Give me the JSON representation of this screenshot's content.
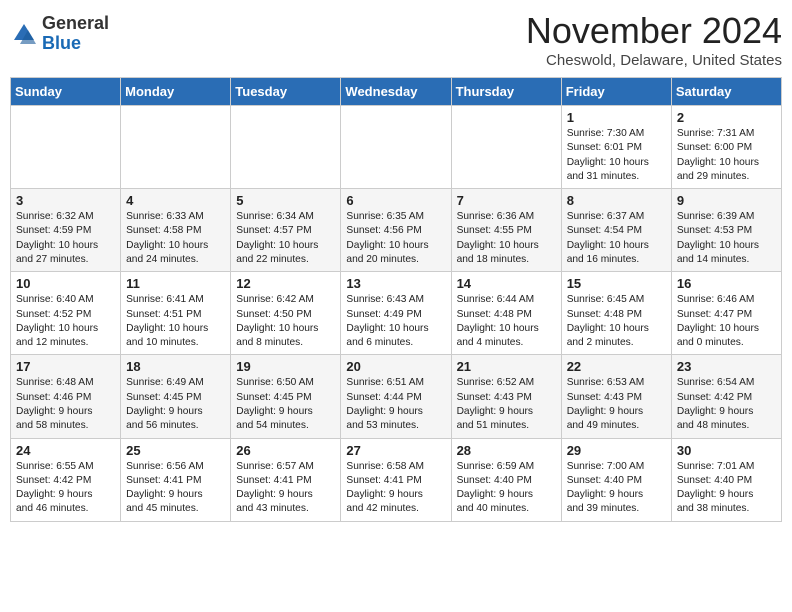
{
  "header": {
    "logo": {
      "general": "General",
      "blue": "Blue"
    },
    "title": "November 2024",
    "location": "Cheswold, Delaware, United States"
  },
  "weekdays": [
    "Sunday",
    "Monday",
    "Tuesday",
    "Wednesday",
    "Thursday",
    "Friday",
    "Saturday"
  ],
  "weeks": [
    [
      {
        "day": "",
        "info": ""
      },
      {
        "day": "",
        "info": ""
      },
      {
        "day": "",
        "info": ""
      },
      {
        "day": "",
        "info": ""
      },
      {
        "day": "",
        "info": ""
      },
      {
        "day": "1",
        "info": "Sunrise: 7:30 AM\nSunset: 6:01 PM\nDaylight: 10 hours\nand 31 minutes."
      },
      {
        "day": "2",
        "info": "Sunrise: 7:31 AM\nSunset: 6:00 PM\nDaylight: 10 hours\nand 29 minutes."
      }
    ],
    [
      {
        "day": "3",
        "info": "Sunrise: 6:32 AM\nSunset: 4:59 PM\nDaylight: 10 hours\nand 27 minutes."
      },
      {
        "day": "4",
        "info": "Sunrise: 6:33 AM\nSunset: 4:58 PM\nDaylight: 10 hours\nand 24 minutes."
      },
      {
        "day": "5",
        "info": "Sunrise: 6:34 AM\nSunset: 4:57 PM\nDaylight: 10 hours\nand 22 minutes."
      },
      {
        "day": "6",
        "info": "Sunrise: 6:35 AM\nSunset: 4:56 PM\nDaylight: 10 hours\nand 20 minutes."
      },
      {
        "day": "7",
        "info": "Sunrise: 6:36 AM\nSunset: 4:55 PM\nDaylight: 10 hours\nand 18 minutes."
      },
      {
        "day": "8",
        "info": "Sunrise: 6:37 AM\nSunset: 4:54 PM\nDaylight: 10 hours\nand 16 minutes."
      },
      {
        "day": "9",
        "info": "Sunrise: 6:39 AM\nSunset: 4:53 PM\nDaylight: 10 hours\nand 14 minutes."
      }
    ],
    [
      {
        "day": "10",
        "info": "Sunrise: 6:40 AM\nSunset: 4:52 PM\nDaylight: 10 hours\nand 12 minutes."
      },
      {
        "day": "11",
        "info": "Sunrise: 6:41 AM\nSunset: 4:51 PM\nDaylight: 10 hours\nand 10 minutes."
      },
      {
        "day": "12",
        "info": "Sunrise: 6:42 AM\nSunset: 4:50 PM\nDaylight: 10 hours\nand 8 minutes."
      },
      {
        "day": "13",
        "info": "Sunrise: 6:43 AM\nSunset: 4:49 PM\nDaylight: 10 hours\nand 6 minutes."
      },
      {
        "day": "14",
        "info": "Sunrise: 6:44 AM\nSunset: 4:48 PM\nDaylight: 10 hours\nand 4 minutes."
      },
      {
        "day": "15",
        "info": "Sunrise: 6:45 AM\nSunset: 4:48 PM\nDaylight: 10 hours\nand 2 minutes."
      },
      {
        "day": "16",
        "info": "Sunrise: 6:46 AM\nSunset: 4:47 PM\nDaylight: 10 hours\nand 0 minutes."
      }
    ],
    [
      {
        "day": "17",
        "info": "Sunrise: 6:48 AM\nSunset: 4:46 PM\nDaylight: 9 hours\nand 58 minutes."
      },
      {
        "day": "18",
        "info": "Sunrise: 6:49 AM\nSunset: 4:45 PM\nDaylight: 9 hours\nand 56 minutes."
      },
      {
        "day": "19",
        "info": "Sunrise: 6:50 AM\nSunset: 4:45 PM\nDaylight: 9 hours\nand 54 minutes."
      },
      {
        "day": "20",
        "info": "Sunrise: 6:51 AM\nSunset: 4:44 PM\nDaylight: 9 hours\nand 53 minutes."
      },
      {
        "day": "21",
        "info": "Sunrise: 6:52 AM\nSunset: 4:43 PM\nDaylight: 9 hours\nand 51 minutes."
      },
      {
        "day": "22",
        "info": "Sunrise: 6:53 AM\nSunset: 4:43 PM\nDaylight: 9 hours\nand 49 minutes."
      },
      {
        "day": "23",
        "info": "Sunrise: 6:54 AM\nSunset: 4:42 PM\nDaylight: 9 hours\nand 48 minutes."
      }
    ],
    [
      {
        "day": "24",
        "info": "Sunrise: 6:55 AM\nSunset: 4:42 PM\nDaylight: 9 hours\nand 46 minutes."
      },
      {
        "day": "25",
        "info": "Sunrise: 6:56 AM\nSunset: 4:41 PM\nDaylight: 9 hours\nand 45 minutes."
      },
      {
        "day": "26",
        "info": "Sunrise: 6:57 AM\nSunset: 4:41 PM\nDaylight: 9 hours\nand 43 minutes."
      },
      {
        "day": "27",
        "info": "Sunrise: 6:58 AM\nSunset: 4:41 PM\nDaylight: 9 hours\nand 42 minutes."
      },
      {
        "day": "28",
        "info": "Sunrise: 6:59 AM\nSunset: 4:40 PM\nDaylight: 9 hours\nand 40 minutes."
      },
      {
        "day": "29",
        "info": "Sunrise: 7:00 AM\nSunset: 4:40 PM\nDaylight: 9 hours\nand 39 minutes."
      },
      {
        "day": "30",
        "info": "Sunrise: 7:01 AM\nSunset: 4:40 PM\nDaylight: 9 hours\nand 38 minutes."
      }
    ]
  ]
}
